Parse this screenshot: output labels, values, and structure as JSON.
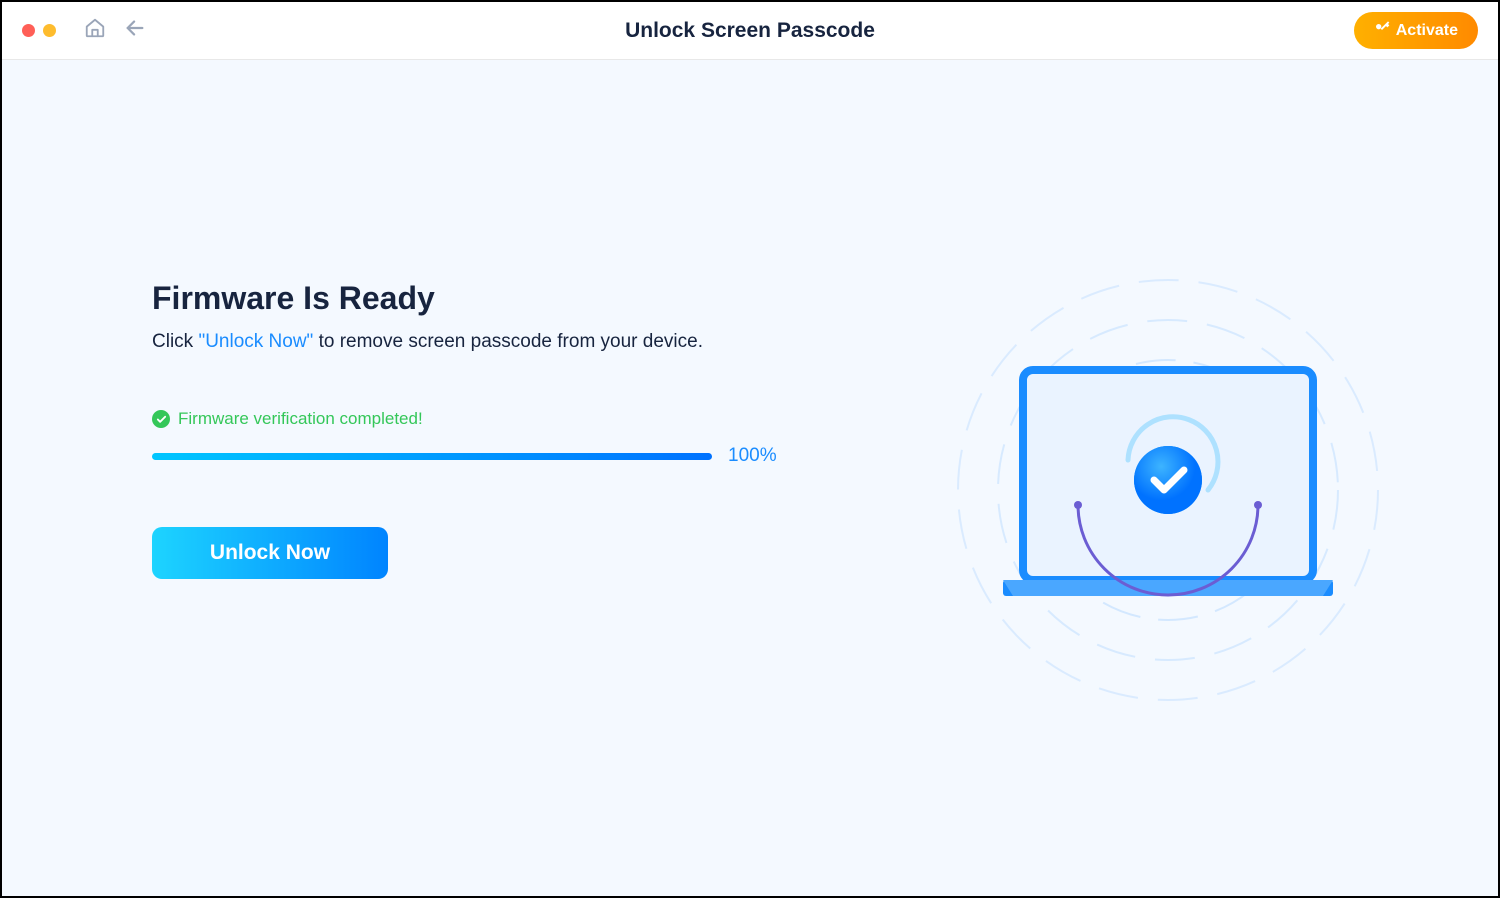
{
  "titlebar": {
    "title": "Unlock Screen Passcode",
    "activate_label": "Activate"
  },
  "main": {
    "heading": "Firmware Is Ready",
    "subtitle_prefix": "Click ",
    "subtitle_highlight": "\"Unlock Now\"",
    "subtitle_suffix": " to remove screen passcode from your device.",
    "status_text": "Firmware verification completed!",
    "progress_percent": "100%",
    "unlock_button_label": "Unlock Now"
  },
  "colors": {
    "accent_blue": "#1a8cff",
    "success_green": "#34c759",
    "activate_gradient_start": "#ffb000",
    "activate_gradient_end": "#ff8a00"
  }
}
